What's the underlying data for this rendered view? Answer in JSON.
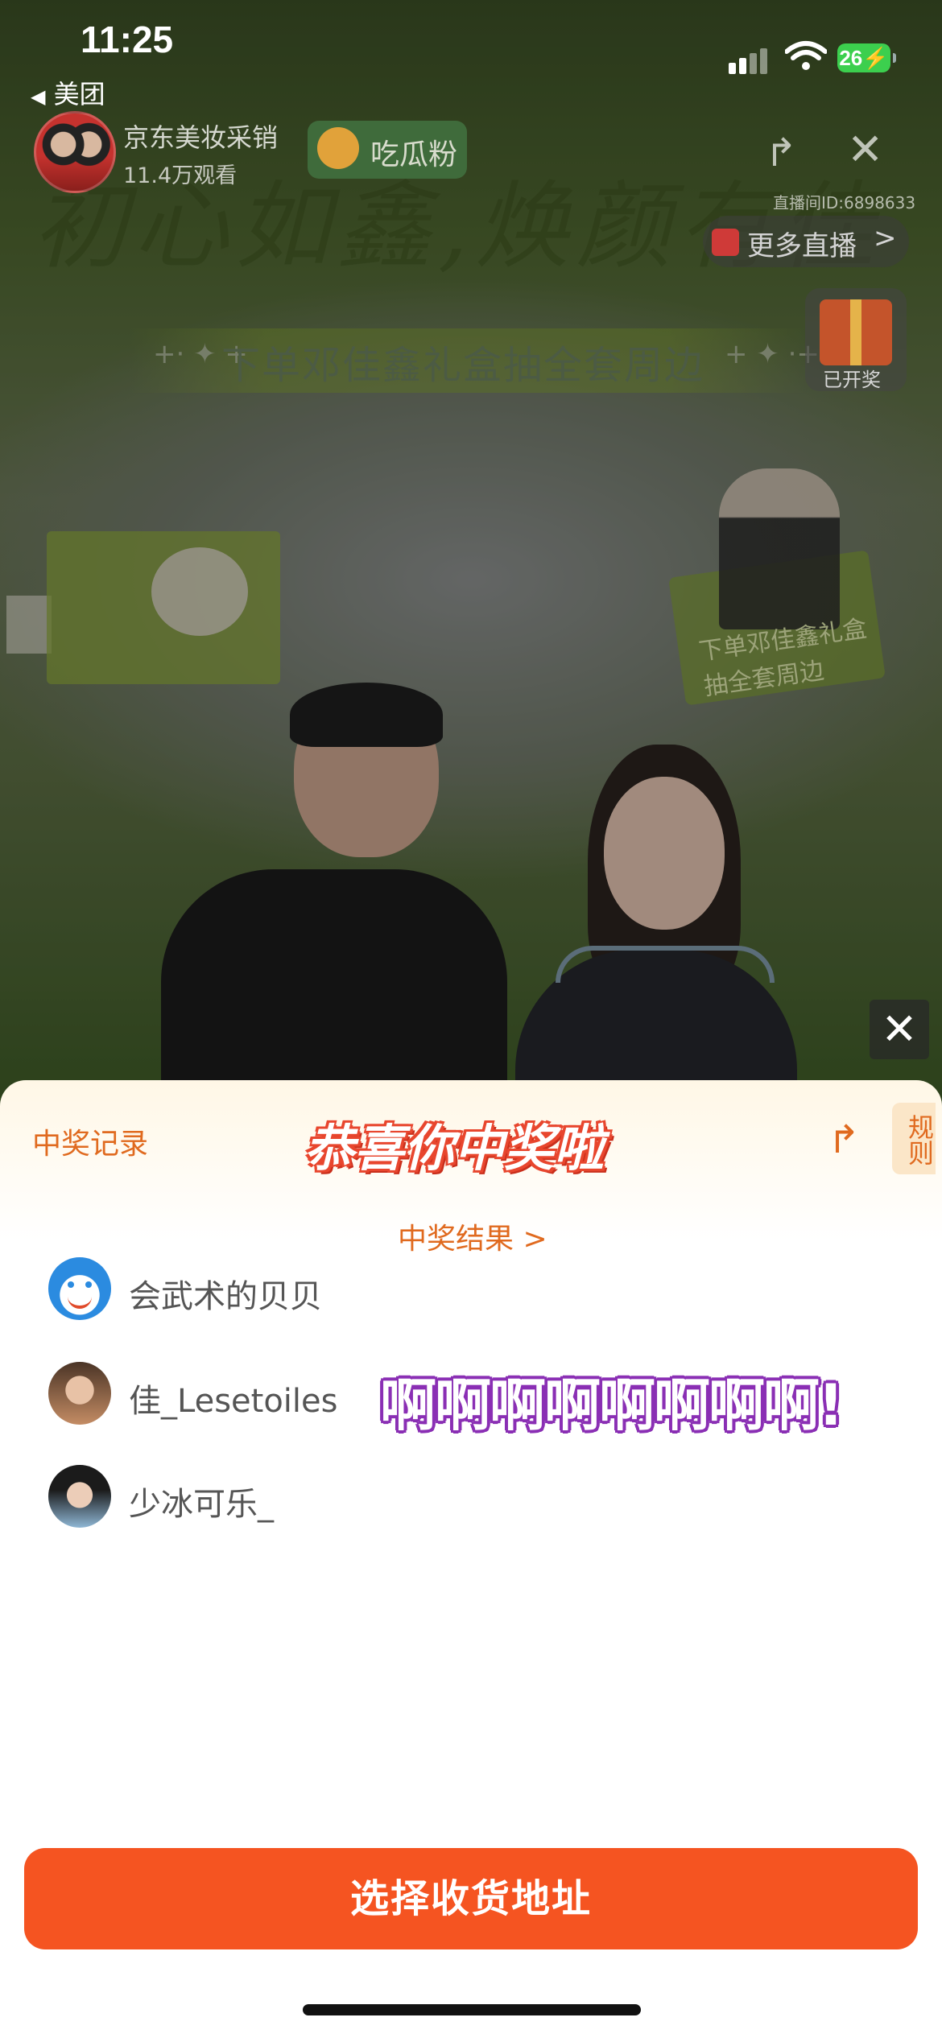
{
  "status_bar": {
    "time": "11:25",
    "back_app": "美团",
    "battery": "26"
  },
  "live": {
    "host_name": "京东美妆采销",
    "viewers": "11.4万观看",
    "fan_badge": "吃瓜粉",
    "room_id": "直播间ID:6898633",
    "more_live": "更多直播",
    "slogan": "初心如鑫,焕颜有佳",
    "promo": "下单邓佳鑫礼盒抽全套周边",
    "promo_stars_left": "+· ✦ +",
    "promo_stars_right": "+ ✦ ·+",
    "gift_label": "已开奖",
    "product_right_text": "下单邓佳鑫礼盒\n抽全套周边"
  },
  "sheet": {
    "records": "中奖记录",
    "title": "恭喜你中奖啦",
    "rules": "规则",
    "result_link": "中奖结果 >",
    "winners": [
      {
        "name": "会武术的贝贝"
      },
      {
        "name": "佳_Lesetoiles"
      },
      {
        "name": "少冰可乐_"
      }
    ],
    "overlay_text": "啊啊啊啊啊啊啊啊!",
    "address_button": "选择收货地址"
  },
  "icons": {
    "back": "◀",
    "share": "↱",
    "close": "✕",
    "more_arrow": ">"
  },
  "colors": {
    "accent": "#f55421",
    "orange_text": "#e06a1f",
    "overlay_purple": "#8a2fb4"
  }
}
